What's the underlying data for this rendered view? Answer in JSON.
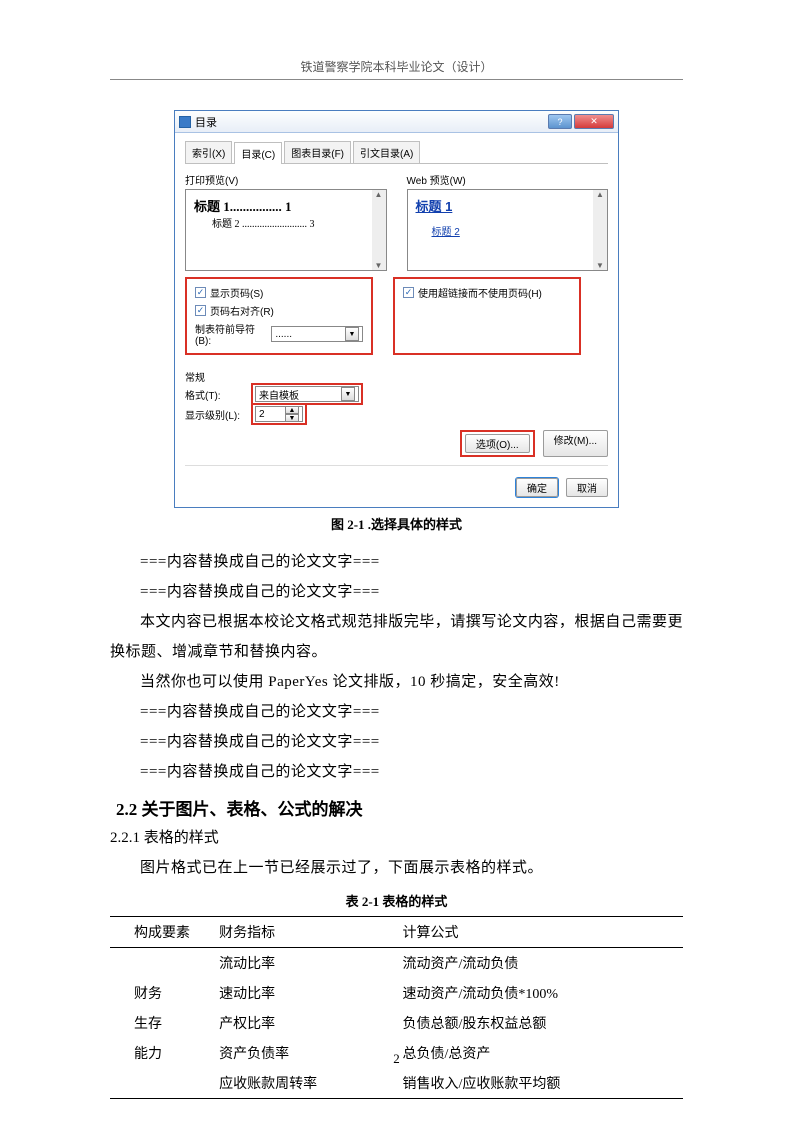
{
  "header": "铁道警察学院本科毕业论文（设计）",
  "dialog": {
    "title": "目录",
    "tabs": [
      "索引(X)",
      "目录(C)",
      "图表目录(F)",
      "引文目录(A)"
    ],
    "preview_label": "打印预览(V)",
    "web_label": "Web 预览(W)",
    "h1": "标题 1",
    "h1dots": "................ 1",
    "h2": "标题 2",
    "h2dots": ".......................... 3",
    "web_h1": "标题 1",
    "web_h2": "标题 2",
    "chk1": "显示页码(S)",
    "chk2": "页码右对齐(R)",
    "chk3": "使用超链接而不使用页码(H)",
    "tab_leader_label": "制表符前导符(B):",
    "tab_leader_value": "......",
    "general_label": "常规",
    "format_label": "格式(T):",
    "format_value": "来自模板",
    "level_label": "显示级别(L):",
    "level_value": "2",
    "opt_btn": "选项(O)...",
    "mod_btn": "修改(M)...",
    "ok": "确定",
    "cancel": "取消"
  },
  "figcap": "图 2-1 .选择具体的样式",
  "paras": {
    "p1": "===内容替换成自己的论文文字===",
    "p2": "===内容替换成自己的论文文字===",
    "p3": "本文内容已根据本校论文格式规范排版完毕，请撰写论文内容，根据自己需要更换标题、增减章节和替换内容。",
    "p4": "当然你也可以使用 PaperYes 论文排版，10 秒搞定，安全高效!",
    "p5": "===内容替换成自己的论文文字===",
    "p6": "===内容替换成自己的论文文字===",
    "p7": "===内容替换成自己的论文文字==="
  },
  "h2": "2.2 关于图片、表格、公式的解决",
  "h3": "2.2.1 表格的样式",
  "pretable": "图片格式已在上一节已经展示过了，下面展示表格的样式。",
  "tablecap": "表 2-1  表格的样式",
  "tbl": {
    "hd": [
      "构成要素",
      "财务指标",
      "计算公式"
    ],
    "rows": [
      [
        "",
        "流动比率",
        "流动资产/流动负债"
      ],
      [
        "财务",
        "速动比率",
        "速动资产/流动负债*100%"
      ],
      [
        "生存",
        "产权比率",
        "负债总额/股东权益总额"
      ],
      [
        "能力",
        "资产负债率",
        "总负债/总资产"
      ],
      [
        "",
        "应收账款周转率",
        "销售收入/应收账款平均额"
      ]
    ]
  },
  "pagenum": "2"
}
